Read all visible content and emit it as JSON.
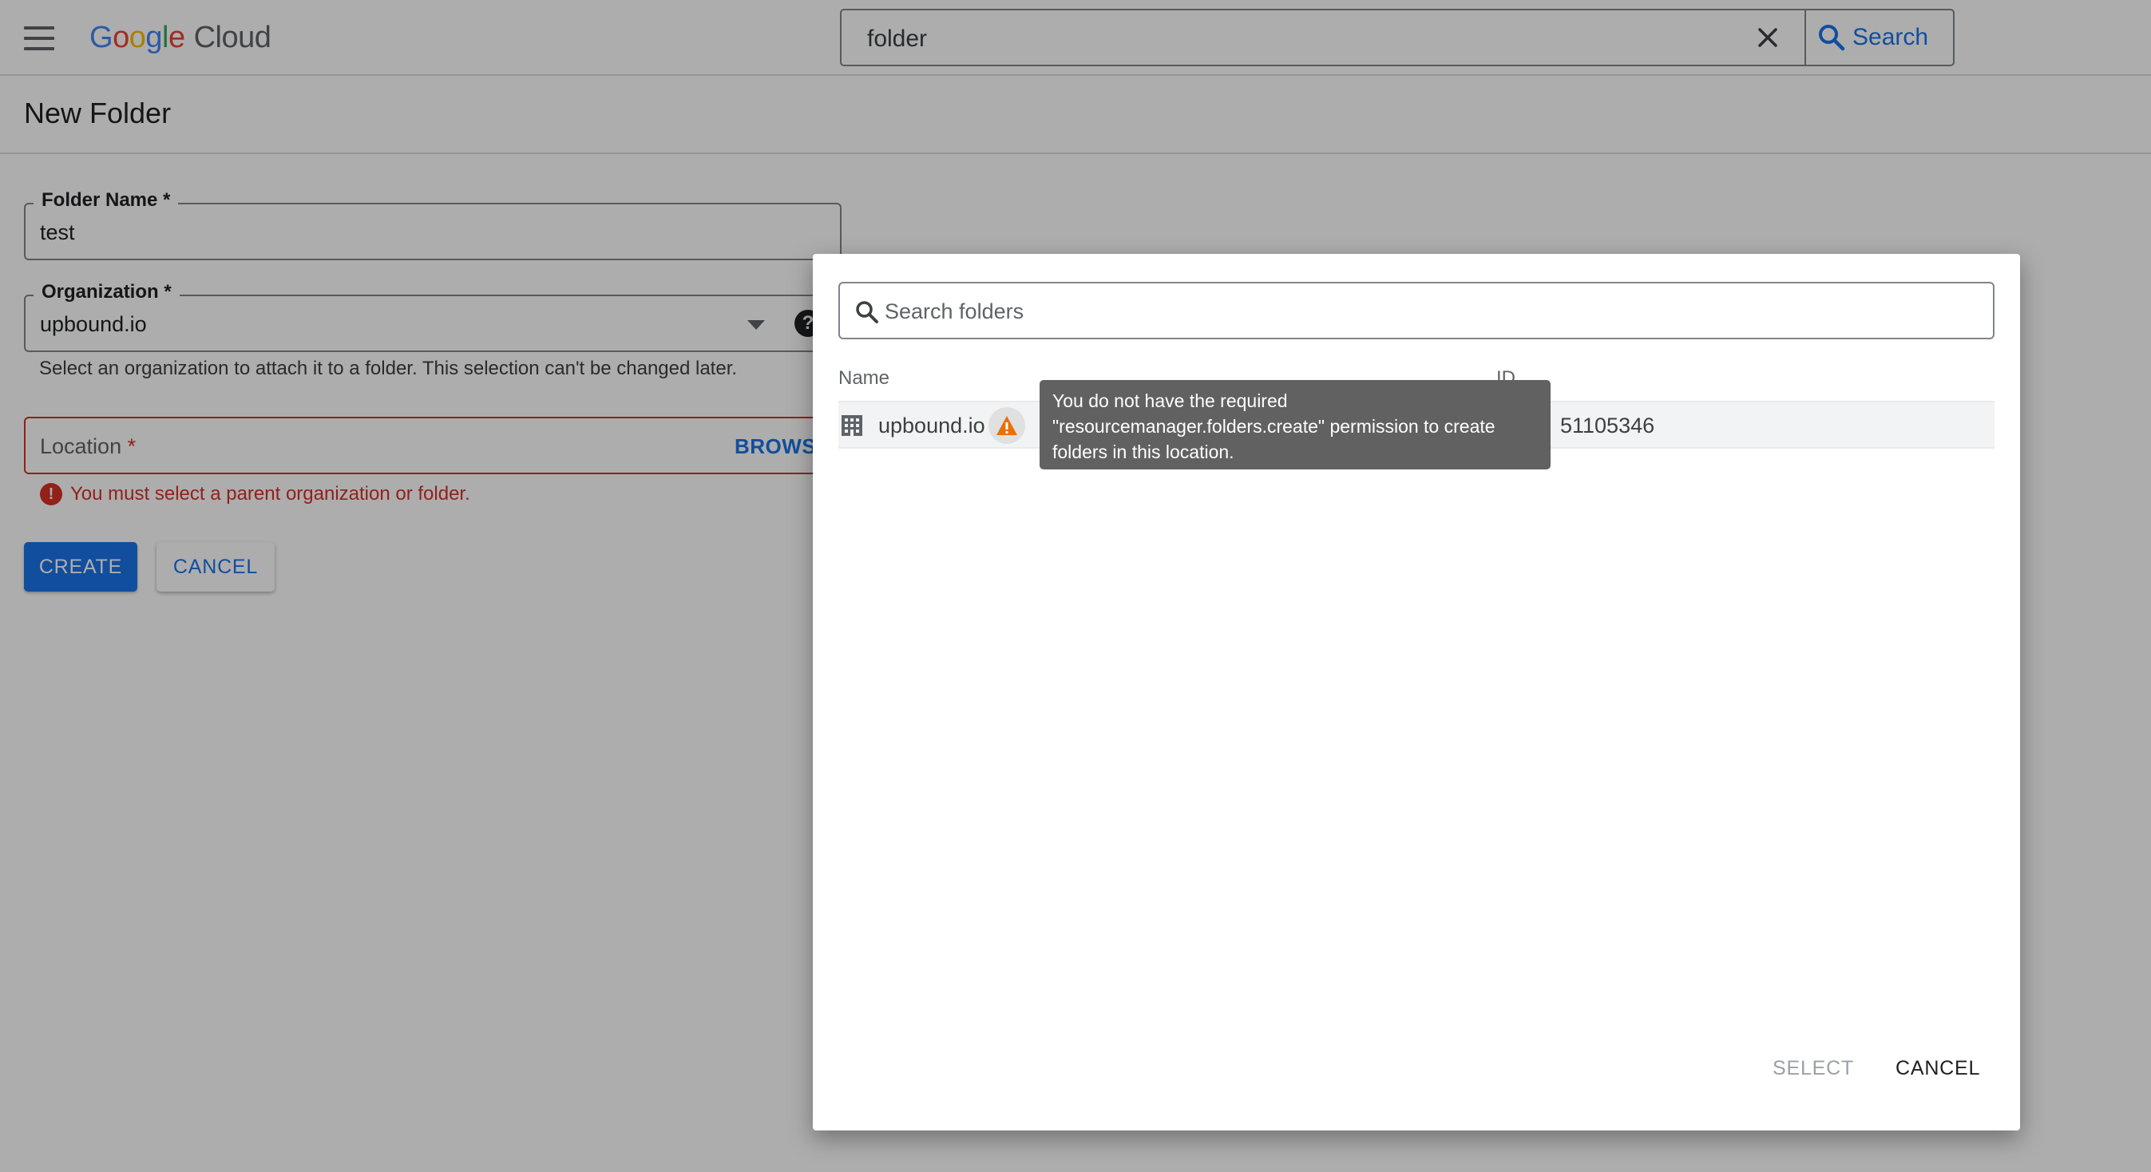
{
  "header": {
    "logo": {
      "google": [
        "G",
        "o",
        "o",
        "g",
        "l",
        "e"
      ],
      "google_colors": [
        "#4285F4",
        "#EA4335",
        "#FBBC04",
        "#4285F4",
        "#34A853",
        "#EA4335"
      ],
      "cloud": "Cloud"
    },
    "search": {
      "query": "folder",
      "button_label": "Search"
    }
  },
  "page": {
    "title": "New Folder",
    "form": {
      "folder_name": {
        "label": "Folder Name *",
        "value": "test"
      },
      "organization": {
        "label": "Organization *",
        "value": "upbound.io",
        "hint": "Select an organization to attach it to a folder. This selection can't be changed later."
      },
      "location": {
        "label": "Location",
        "required_mark": "*",
        "browse_label": "BROWSE",
        "error": "You must select a parent organization or folder."
      },
      "create_label": "CREATE",
      "cancel_label": "CANCEL"
    }
  },
  "dialog": {
    "search_placeholder": "Search folders",
    "columns": {
      "name": "Name",
      "id": "ID"
    },
    "rows": [
      {
        "name": "upbound.io",
        "id": "51105346",
        "icon": "organization-icon",
        "status_icon": "warning-icon"
      }
    ],
    "tooltip": [
      "You do not have the required",
      "\"resourcemanager.folders.create\" permission to create",
      "folders in this location."
    ],
    "select_label": "SELECT",
    "cancel_label": "CANCEL"
  },
  "colors": {
    "accent": "#1a73e8",
    "error": "#d93025",
    "warning": "#e8710a",
    "scrim": "rgba(0,0,0,0.32)"
  }
}
